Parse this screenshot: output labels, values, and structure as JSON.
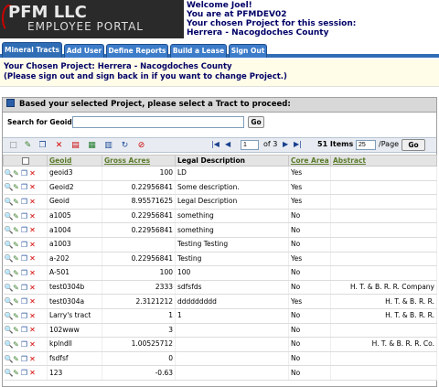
{
  "header": {
    "brand": "PFM",
    "brand_suffix": "LLC",
    "portal": "EMPLOYEE PORTAL",
    "welcome": [
      "Welcome Joel!",
      "You are at PFMDEV02",
      "Your chosen Project for this session:",
      "Herrera - Nacogdoches County"
    ]
  },
  "tabs": [
    {
      "label": "Mineral Tracts",
      "active": true
    },
    {
      "label": "Add User"
    },
    {
      "label": "Define Reports"
    },
    {
      "label": "Build a Lease"
    },
    {
      "label": "Sign Out"
    }
  ],
  "project": {
    "line1": "Your Chosen Project: Herrera - Nacogdoches County",
    "line2": "(Please sign out and sign back in if you want to change Project.)"
  },
  "panel": {
    "title": "Based your selected Project, please select a Tract to proceed:",
    "search_label": "Search for Geoid",
    "search_value": "",
    "go_label": "Go"
  },
  "toolbar": {
    "icons": [
      "new-icon",
      "edit-icon",
      "copy-icon",
      "delete-icon",
      "pdf-icon",
      "excel-icon",
      "word-icon",
      "refresh-icon",
      "clear-filter-icon"
    ]
  },
  "pager": {
    "page": "1",
    "of": "of 3",
    "items": "51 Items",
    "page_size": "25",
    "per_page": "/Page",
    "go": "Go"
  },
  "table": {
    "headers": [
      "",
      "Geoid",
      "Gross Acres",
      "Legal Description",
      "Core Area",
      "Abstract"
    ],
    "rows": [
      [
        "geoid3",
        "100",
        "LD",
        "Yes",
        ""
      ],
      [
        "Geoid2",
        "0.22956841",
        "Some description.",
        "Yes",
        ""
      ],
      [
        "Geoid",
        "8.95571625",
        "Legal Description",
        "Yes",
        ""
      ],
      [
        "a1005",
        "0.22956841",
        "something",
        "No",
        ""
      ],
      [
        "a1004",
        "0.22956841",
        "something",
        "No",
        ""
      ],
      [
        "a1003",
        "",
        "Testing Testing",
        "No",
        ""
      ],
      [
        "a-202",
        "0.22956841",
        "Testing",
        "Yes",
        ""
      ],
      [
        "A-501",
        "100",
        "100",
        "No",
        ""
      ],
      [
        "test0304b",
        "2333",
        "sdfsfds",
        "No",
        "H. T. & B. R. R. Company"
      ],
      [
        "test0304a",
        "2.3121212",
        "ddddddddd",
        "Yes",
        "H. T. & B. R. R."
      ],
      [
        "Larry's tract",
        "1",
        "1",
        "No",
        "H. T. & B. R. R."
      ],
      [
        "102www",
        "3",
        "",
        "No",
        ""
      ],
      [
        "kplndll",
        "1.00525712",
        "",
        "No",
        "H. T. & B. R. R. Co."
      ],
      [
        "fsdfsf",
        "0",
        "",
        "No",
        ""
      ],
      [
        "123",
        "-0.63",
        "",
        "No",
        ""
      ]
    ]
  }
}
